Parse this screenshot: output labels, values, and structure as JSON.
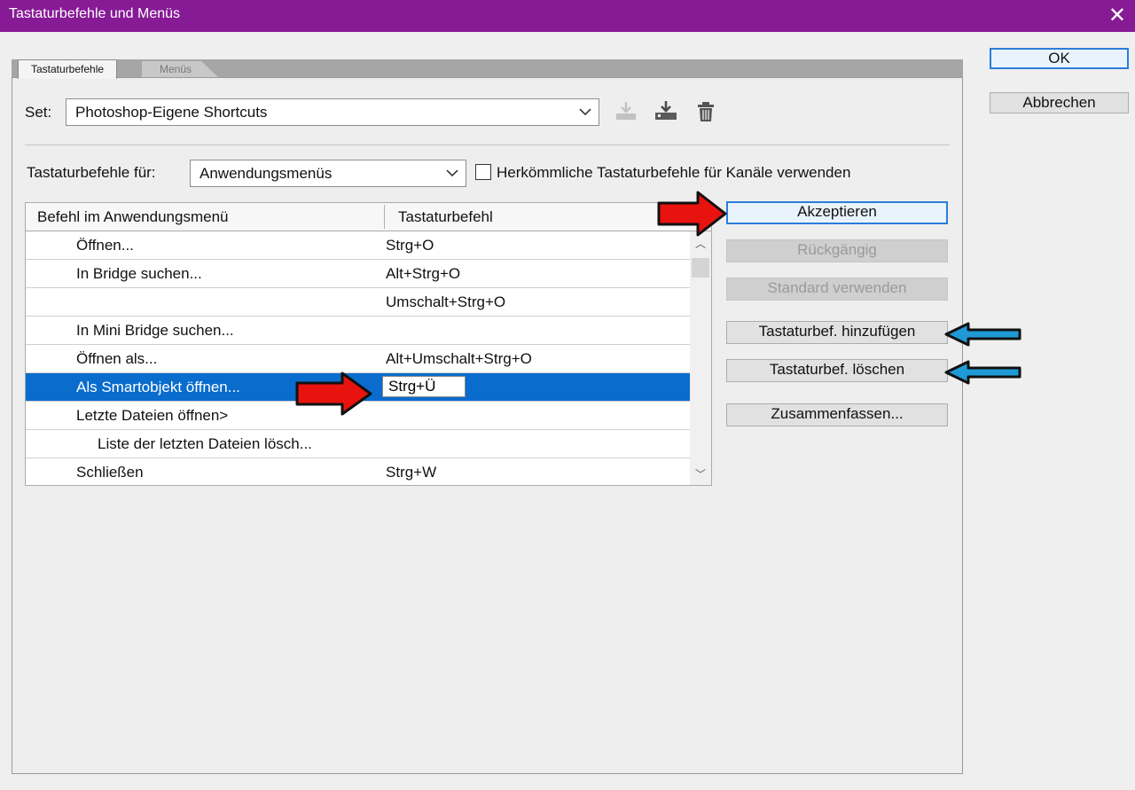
{
  "dialog": {
    "title": "Tastaturbefehle und Menüs",
    "close_glyph": "✕",
    "ok_label": "OK",
    "cancel_label": "Abbrechen"
  },
  "tabs": [
    {
      "label": "Tastaturbefehle",
      "active": true
    },
    {
      "label": "Menüs",
      "active": false
    }
  ],
  "set": {
    "label": "Set:",
    "value": "Photoshop-Eigene Shortcuts",
    "icons": [
      "save-set-icon",
      "save-set-as-icon",
      "trash-icon"
    ]
  },
  "shortcuts_for": {
    "label": "Tastaturbefehle für:",
    "value": "Anwendungsmenüs",
    "checkbox_label": "Herkömmliche Tastaturbefehle für Kanäle verwenden",
    "checkbox_checked": false
  },
  "table": {
    "col1_header": "Befehl im Anwendungsmenü",
    "col2_header": "Tastaturbefehl",
    "rows": [
      {
        "command": "Öffnen...",
        "shortcut": "Strg+O"
      },
      {
        "command": "In Bridge suchen...",
        "shortcut": "Alt+Strg+O"
      },
      {
        "command": "",
        "shortcut": "Umschalt+Strg+O"
      },
      {
        "command": "In Mini Bridge suchen...",
        "shortcut": ""
      },
      {
        "command": "Öffnen als...",
        "shortcut": "Alt+Umschalt+Strg+O"
      },
      {
        "command": "Als Smartobjekt öffnen...",
        "shortcut": "Strg+Ü",
        "selected": true
      },
      {
        "command": "Letzte Dateien öffnen>",
        "shortcut": ""
      },
      {
        "command": "Liste der letzten Dateien lösch...",
        "shortcut": ""
      },
      {
        "command": "Schließen",
        "shortcut": "Strg+W"
      }
    ]
  },
  "side_buttons": {
    "accept": "Akzeptieren",
    "undo": "Rückgängig",
    "use_default": "Standard verwenden",
    "add_shortcut": "Tastaturbef. hinzufügen",
    "delete_shortcut": "Tastaturbef. löschen",
    "summarize": "Zusammenfassen..."
  },
  "colors": {
    "titlebar": "#871b96",
    "selection": "#0a6ccd",
    "annotation_red": "#e8130f",
    "annotation_blue": "#1f9ad6"
  }
}
